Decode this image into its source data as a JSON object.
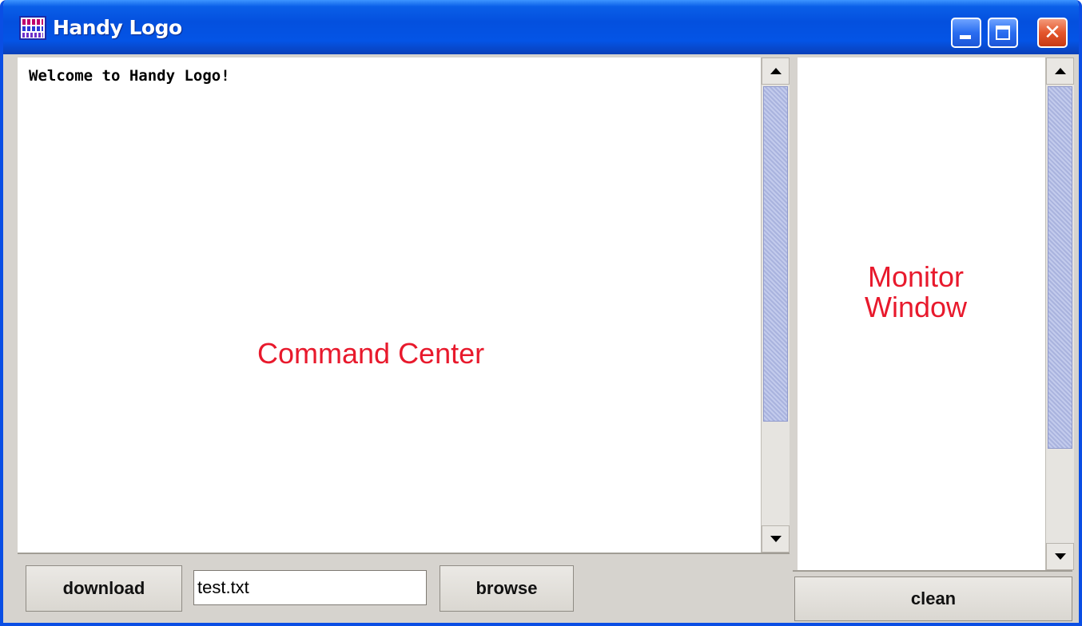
{
  "window": {
    "title": "Handy Logo",
    "title_icon": "handy-logo-app-icon",
    "controls": {
      "minimize": "minimize-icon",
      "maximize": "maximize-icon",
      "close_glyph": "✕"
    }
  },
  "command_center": {
    "welcome_text": "Welcome to Handy Logo!",
    "label": "Command Center"
  },
  "monitor": {
    "label_line1": "Monitor",
    "label_line2": "Window"
  },
  "bottom_bar": {
    "download_label": "download",
    "file_value": "test.txt",
    "browse_label": "browse",
    "clean_label": "clean"
  },
  "colors": {
    "titlebar": "#0454e6",
    "annotation_red": "#e8192c",
    "scroll_thumb": "#b6bfe4",
    "panel_bg": "#d6d3ce"
  }
}
